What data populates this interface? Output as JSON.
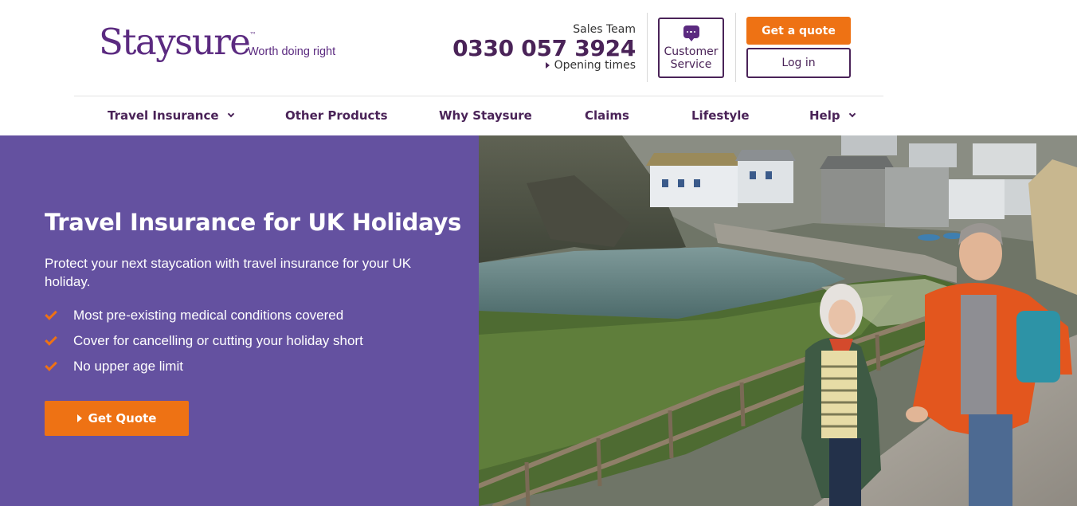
{
  "header": {
    "logo_text": "Staysure",
    "logo_tm": "™",
    "tagline": "Worth doing right",
    "sales_label": "Sales Team",
    "sales_phone": "0330 057 3924",
    "opening_times": "Opening times",
    "customer_service_line1": "Customer",
    "customer_service_line2": "Service",
    "get_quote": "Get a quote",
    "login": "Log in"
  },
  "nav": {
    "items": [
      {
        "label": "Travel Insurance",
        "has_dropdown": true
      },
      {
        "label": "Other Products",
        "has_dropdown": false
      },
      {
        "label": "Why Staysure",
        "has_dropdown": false
      },
      {
        "label": "Claims",
        "has_dropdown": false
      },
      {
        "label": "Lifestyle",
        "has_dropdown": false
      },
      {
        "label": "Help",
        "has_dropdown": true
      }
    ]
  },
  "hero": {
    "title": "Travel Insurance for UK Holidays",
    "subtitle": "Protect your next staycation with travel insurance for your UK holiday.",
    "bullets": [
      "Most pre-existing medical conditions covered",
      "Cover for cancelling or cutting your holiday short",
      "No upper age limit"
    ],
    "cta": "Get Quote"
  },
  "icons": {
    "customer_service": "chat-bubble-icon",
    "opening_times": "play-arrow-icon",
    "nav_dropdown": "chevron-down-icon",
    "bullet": "check-icon",
    "cta": "play-arrow-icon"
  },
  "colors": {
    "brand_purple": "#4a2358",
    "logo_purple": "#5b2a80",
    "hero_purple": "#6451a0",
    "accent_orange": "#ee7214"
  }
}
